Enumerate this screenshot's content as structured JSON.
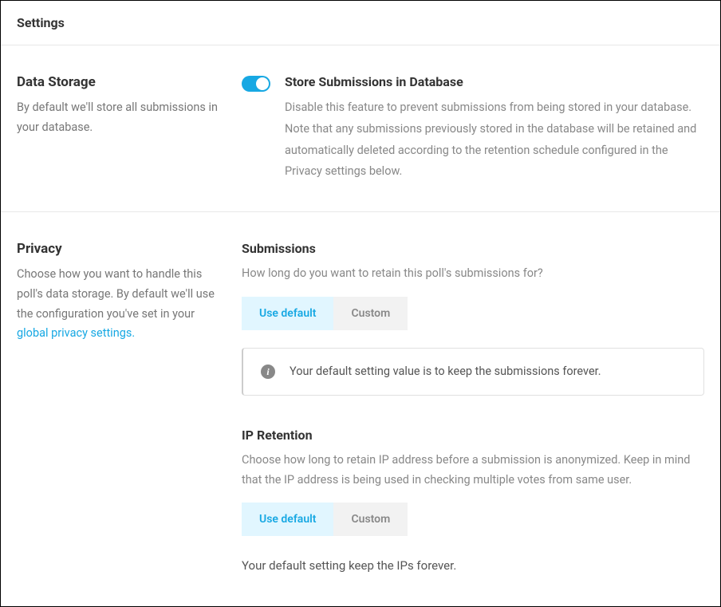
{
  "header": {
    "title": "Settings"
  },
  "dataStorage": {
    "title": "Data Storage",
    "description": "By default we'll store all submissions in your database.",
    "toggle": {
      "title": "Store Submissions in Database",
      "description": "Disable this feature to prevent submissions from being stored in your database. Note that any submissions previously stored in the database will be retained and automatically deleted according to the retention schedule configured in the Privacy settings below."
    }
  },
  "privacy": {
    "title": "Privacy",
    "descriptionPrefix": "Choose how you want to handle this poll's data storage. By default we'll use the configuration you've set in your ",
    "linkText": "global privacy settings.",
    "submissions": {
      "title": "Submissions",
      "description": "How long do you want to retain this poll's submissions for?",
      "buttons": {
        "default": "Use default",
        "custom": "Custom"
      },
      "infoText": "Your default setting value is to keep the submissions forever."
    },
    "ipRetention": {
      "title": "IP Retention",
      "description": "Choose how long to retain IP address before a submission is anonymized. Keep in mind that the IP address is being used in checking multiple votes from same user.",
      "buttons": {
        "default": "Use default",
        "custom": "Custom"
      },
      "note": "Your default setting keep the IPs forever."
    }
  }
}
